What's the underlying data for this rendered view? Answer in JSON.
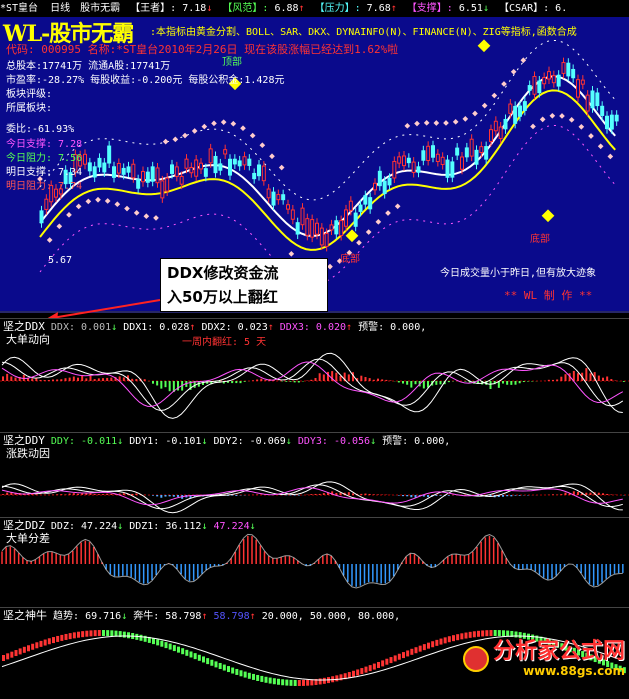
{
  "titlebar": {
    "stock": "*ST皇台",
    "period": "日线",
    "indicator": "股市无霸",
    "items": [
      {
        "label": "【王者】:",
        "value": "7.18",
        "arrow": "↓"
      },
      {
        "label": "【风范】:",
        "value": "6.88",
        "arrow": "↑"
      },
      {
        "label": "【压力】:",
        "value": "7.68",
        "arrow": "↑"
      },
      {
        "label": "【支撑】:",
        "value": "6.51",
        "arrow": "↓"
      },
      {
        "label": "【CSAR】:",
        "value": "6.",
        "arrow": ""
      }
    ]
  },
  "main": {
    "logo": "WL-股市无霸",
    "desc": ":本指标由黄金分割、BOLL、SAR、DKX、DYNAINFO(N)、FINANCE(N)、ZIG等指标,函数合成",
    "code_line": "代码: 000995    名称:*ST皇台2010年2月26日 现在该股涨幅已经达到1.62%啦",
    "info": [
      "总股本:17741万 流通A股:17741万",
      "市盈率:-28.27% 每股收益:-0.200元 每股公积金:1.428元",
      "板块评级:",
      "所属板块:",
      "委比:-61.93%"
    ],
    "levels": [
      {
        "text": "今日支撑: 7.28",
        "color": "#ff55ff"
      },
      {
        "text": "今日阻力: 7.56",
        "color": "#55ff55"
      },
      {
        "text": "明日支撑: 7.34",
        "color": "#ffffff"
      },
      {
        "text": "明日阻力: 7.74",
        "color": "#ff5555"
      }
    ],
    "label_top": "顶部",
    "label_bottom_1": "底部",
    "label_bottom_2": "底部",
    "price_low": "5.67",
    "notice": "今日成交量小于昨日,但有放大迹象",
    "credit": "** WL 制 作 **"
  },
  "callout": {
    "line1": "DDX修改资金流",
    "line2": "入50万以上翻红"
  },
  "panels": [
    {
      "name": "坚之DDX",
      "subtitle": "大单动向",
      "values": [
        {
          "text": "DDX: 0.001",
          "arrow": "↓",
          "color": "#bbbbbb"
        },
        {
          "text": "DDX1: 0.028",
          "arrow": "↑",
          "color": "#ffffff"
        },
        {
          "text": "DDX2: 0.023",
          "arrow": "↑",
          "color": "#ffffff"
        },
        {
          "text": "DDX3: 0.020",
          "arrow": "↑",
          "color": "#ff55ff"
        },
        {
          "text": "预警: 0.000,",
          "arrow": "",
          "color": "#ffffff"
        }
      ],
      "note": "一周内翻红: 5 天"
    },
    {
      "name": "坚之DDY",
      "subtitle": "涨跌动因",
      "values": [
        {
          "text": "DDY: -0.011",
          "arrow": "↓",
          "color": "#55ff55"
        },
        {
          "text": "DDY1: -0.101",
          "arrow": "↓",
          "color": "#ffffff"
        },
        {
          "text": "DDY2: -0.069",
          "arrow": "↓",
          "color": "#ffffff"
        },
        {
          "text": "DDY3: -0.056",
          "arrow": "↓",
          "color": "#ff55ff"
        },
        {
          "text": "预警: 0.000,",
          "arrow": "",
          "color": "#ffffff"
        }
      ]
    },
    {
      "name": "坚之DDZ",
      "subtitle": "大单分差",
      "values": [
        {
          "text": "DDZ: 47.224",
          "arrow": "↓",
          "color": "#ffffff"
        },
        {
          "text": "DDZ1: 36.112",
          "arrow": "↓",
          "color": "#ffffff"
        },
        {
          "text": "47.224",
          "arrow": "↓",
          "color": "#ff55ff"
        }
      ]
    },
    {
      "name": "坚之神牛",
      "values": [
        {
          "text": "趋势: 69.716",
          "arrow": "↓",
          "color": "#ffffff"
        },
        {
          "text": "奔牛: 58.798",
          "arrow": "↑",
          "color": "#ffffff"
        },
        {
          "text": "58.798",
          "arrow": "↑",
          "color": "#5555ff"
        },
        {
          "text": "20.000, 50.000, 80.000,",
          "arrow": "",
          "color": "#ffffff"
        }
      ]
    }
  ],
  "watermark": {
    "name": "分析家公式网",
    "url": "www.88gs.com"
  }
}
